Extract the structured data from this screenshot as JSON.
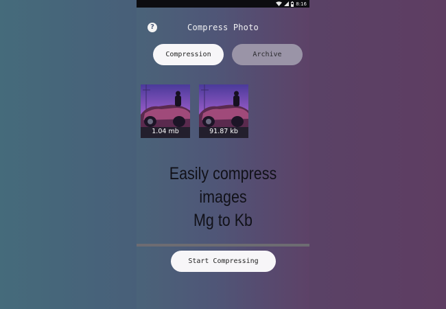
{
  "status_bar": {
    "time": "8:16",
    "icons": [
      "wifi-icon",
      "signal-icon",
      "battery-icon"
    ]
  },
  "header": {
    "help_icon": "question-mark-icon",
    "help_glyph": "?",
    "title": "Compress Photo"
  },
  "tabs": [
    {
      "label": "Compression",
      "active": true
    },
    {
      "label": "Archive",
      "active": false
    }
  ],
  "thumbnails": [
    {
      "size_label": "1.04 mb"
    },
    {
      "size_label": "91.87 kb"
    }
  ],
  "headline": {
    "line1": "Easily compress images",
    "line2": "Mg to Kb"
  },
  "progress": {
    "value": 0
  },
  "actions": {
    "start_label": "Start Compressing"
  },
  "colors": {
    "background_left": "#466679",
    "background_right": "#5b3f66",
    "button_light": "#f7f6f8",
    "button_inactive": "#9a94a7"
  }
}
